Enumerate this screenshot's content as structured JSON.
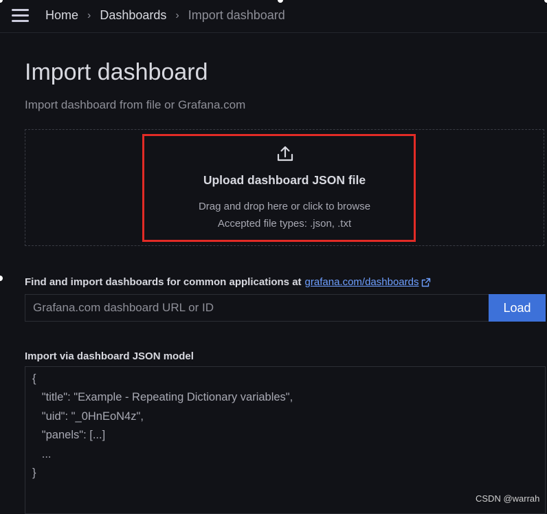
{
  "breadcrumb": {
    "items": [
      "Home",
      "Dashboards"
    ],
    "current": "Import dashboard",
    "separator": "›"
  },
  "header": {
    "title": "Import dashboard",
    "subtitle": "Import dashboard from file or Grafana.com"
  },
  "upload": {
    "icon": "upload-icon",
    "title": "Upload dashboard JSON file",
    "hint_line1": "Drag and drop here or click to browse",
    "hint_line2": "Accepted file types: .json, .txt",
    "highlight_color": "#e22b26"
  },
  "grafana_com": {
    "label": "Find and import dashboards for common applications at",
    "link_text": "grafana.com/dashboards",
    "link_icon": "external-link-icon",
    "input_value": "",
    "input_placeholder": "Grafana.com dashboard URL or ID",
    "load_button": "Load",
    "accent_color": "#3d71d9"
  },
  "json_model": {
    "label": "Import via dashboard JSON model",
    "lines": [
      "{",
      "   \"title\": \"Example - Repeating Dictionary variables\",",
      "   \"uid\": \"_0HnEoN4z\",",
      "   \"panels\": [...]",
      "   ...",
      "}"
    ]
  },
  "watermark": "CSDN @warrah"
}
